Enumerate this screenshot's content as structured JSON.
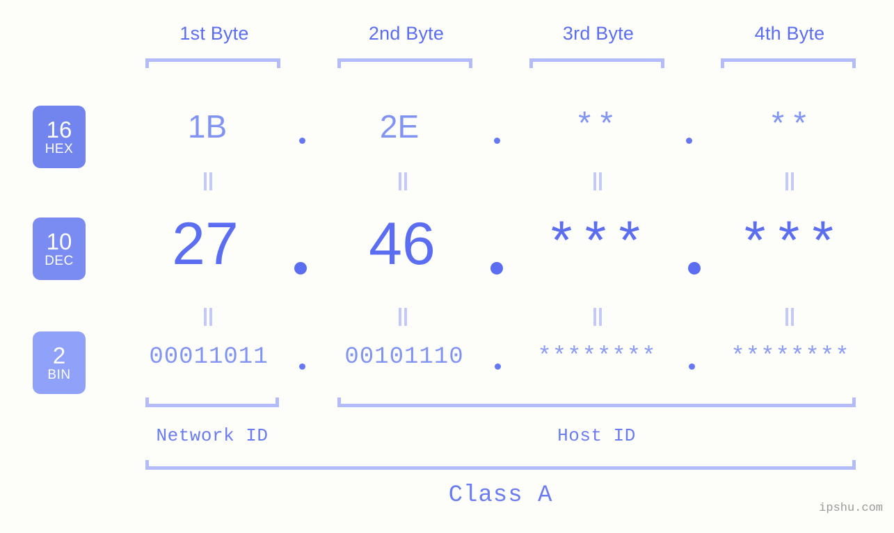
{
  "page": {
    "background_color": "#fdfdfa",
    "accent_color": "#5b6df0",
    "accent_light_color": "#b3bbfb",
    "watermark": "ipshu.com"
  },
  "byte_headers": [
    {
      "label": "1st Byte"
    },
    {
      "label": "2nd Byte"
    },
    {
      "label": "3rd Byte"
    },
    {
      "label": "4th Byte"
    }
  ],
  "bases": [
    {
      "number": "16",
      "name": "HEX",
      "color": "#7285ef"
    },
    {
      "number": "10",
      "name": "DEC",
      "color": "#7a8cf2"
    },
    {
      "number": "2",
      "name": "BIN",
      "color": "#8fa1f9"
    }
  ],
  "rows": {
    "hex": {
      "base_number": "16",
      "base_name": "HEX",
      "values": [
        "1B",
        "2E",
        "**",
        "**"
      ],
      "separators": [
        ".",
        ".",
        "."
      ]
    },
    "dec": {
      "base_number": "10",
      "base_name": "DEC",
      "values": [
        "27",
        "46",
        "***",
        "***"
      ],
      "separators": [
        ".",
        ".",
        "."
      ]
    },
    "bin": {
      "base_number": "2",
      "base_name": "BIN",
      "values": [
        "00011011",
        "00101110",
        "********",
        "********"
      ],
      "separators": [
        ".",
        ".",
        "."
      ]
    }
  },
  "equals_symbol": "=",
  "segments": {
    "network_id": {
      "label": "Network ID"
    },
    "host_id": {
      "label": "Host ID"
    },
    "class": {
      "label": "Class A"
    }
  }
}
